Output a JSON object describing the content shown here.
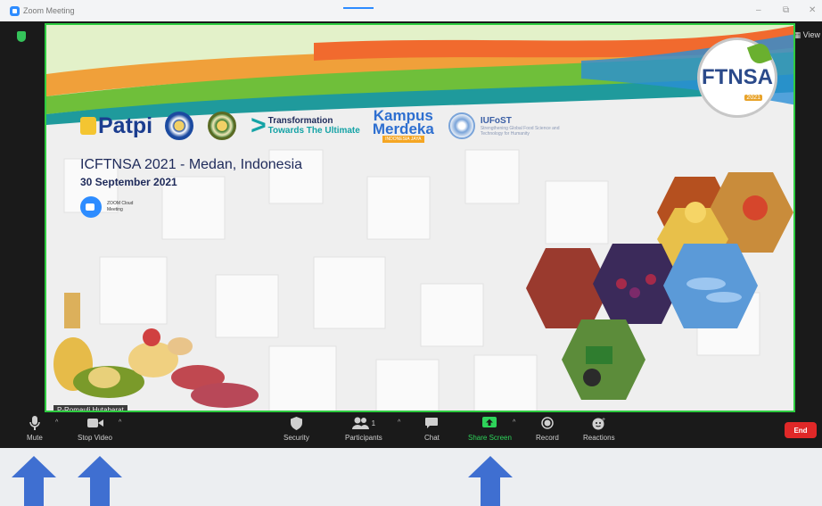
{
  "window": {
    "title": "Zoom Meeting",
    "minimize": "–",
    "maximize": "⧉",
    "close": "✕"
  },
  "meeting": {
    "view_label": "View",
    "participant_name": "P-Romauli Hutabarat"
  },
  "slide": {
    "logos": {
      "patpi": "Patpi",
      "transformation_line1": "Transformation",
      "transformation_line2": "Towards The Ultimate",
      "kampus_line1": "Kampus",
      "kampus_line2": "Merdeka",
      "kampus_line3": "INDONESIA JAYA",
      "iufost_name": "IUFoST",
      "iufost_sub": "Strengthening Global Food Science and Technology for Humanity"
    },
    "title": "ICFTNSA 2021 - Medan, Indonesia",
    "date": "30 September 2021",
    "zoom_cloud_line1": "ZOOM Cloud",
    "zoom_cloud_line2": "Meeting",
    "emblem_text": "FTNSA",
    "emblem_year": "2021"
  },
  "toolbar": {
    "mute": "Mute",
    "stop_video": "Stop Video",
    "security": "Security",
    "participants": "Participants",
    "participants_count": "1",
    "chat": "Chat",
    "share_screen": "Share Screen",
    "record": "Record",
    "reactions": "Reactions",
    "end": "End",
    "caret": "^"
  },
  "colors": {
    "share_green": "#2ed35a",
    "end_red": "#e02828",
    "zoom_blue": "#2d8cff",
    "arrow_blue": "#3f6fd1"
  }
}
